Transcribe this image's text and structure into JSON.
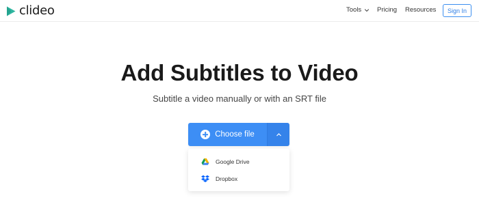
{
  "brand": {
    "name": "clideo",
    "color": "#2fb6a0"
  },
  "nav": {
    "tools_label": "Tools",
    "pricing_label": "Pricing",
    "resources_label": "Resources",
    "signin_label": "Sign In"
  },
  "hero": {
    "title": "Add Subtitles to Video",
    "subtitle": "Subtitle a video manually or with an SRT file"
  },
  "upload": {
    "choose_label": "Choose file",
    "accent": "#3d8ef5",
    "menu": [
      {
        "label": "Google Drive",
        "icon": "google-drive-icon"
      },
      {
        "label": "Dropbox",
        "icon": "dropbox-icon"
      }
    ]
  }
}
